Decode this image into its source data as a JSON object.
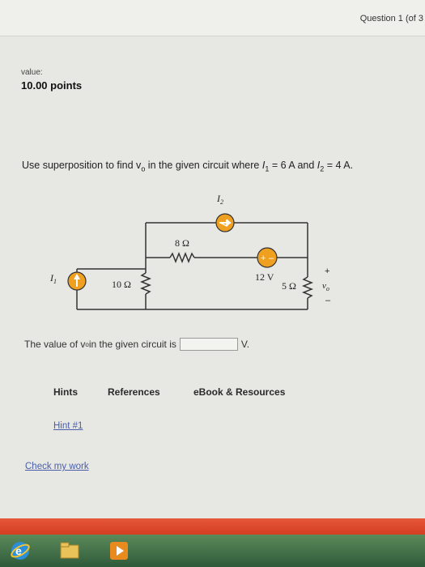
{
  "header": {
    "question_label": "Question 1 (of 3"
  },
  "score": {
    "value_label": "value:",
    "points": "10.00 points"
  },
  "problem": {
    "prefix": "Use superposition to find v",
    "sub_o": "o",
    "middle": " in the given circuit where ",
    "i1": "I",
    "i1_sub": "1",
    "eq1": " = 6 A and ",
    "i2": "I",
    "i2_sub": "2",
    "eq2": " = 4 A."
  },
  "circuit": {
    "i2_label": "I",
    "i2_sub": "2",
    "r8": "8 Ω",
    "i1_label": "I",
    "i1_sub": "1",
    "r10": "10 Ω",
    "v12": "12 V",
    "r5": "5 Ω",
    "vo_plus": "+",
    "vo_minus": "–",
    "vo": "v",
    "vo_sub": "o",
    "src_plus": "+",
    "src_minus": "–"
  },
  "answer": {
    "prefix": "The value of v",
    "sub": "o",
    "suffix": " in the given circuit is",
    "input_value": "",
    "unit": "V."
  },
  "tabs": {
    "hints": "Hints",
    "references": "References",
    "ebook": "eBook & Resources"
  },
  "links": {
    "hint1": "Hint #1",
    "check": "Check my work"
  },
  "colors": {
    "source_fill": "#f0a020",
    "footer": "#d8462a"
  }
}
